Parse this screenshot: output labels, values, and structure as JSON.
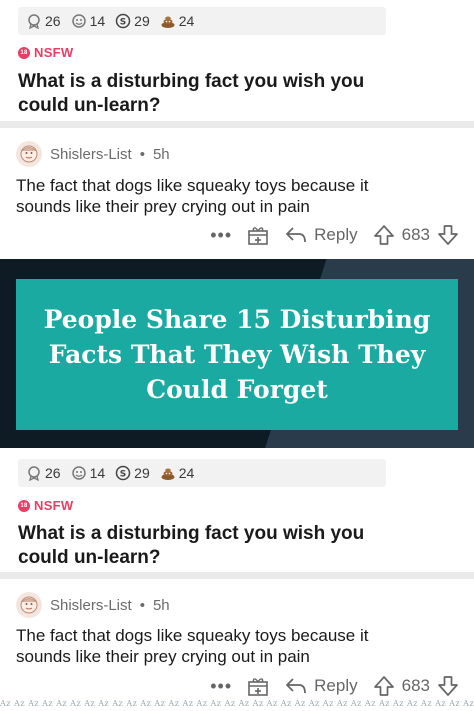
{
  "awards": [
    {
      "icon": "silver-award-icon",
      "count": "26"
    },
    {
      "icon": "helpful-award-icon",
      "count": "14"
    },
    {
      "icon": "coin-award-icon",
      "count": "29"
    },
    {
      "icon": "poop-award-icon",
      "count": "24"
    }
  ],
  "post": {
    "nsfw_label": "NSFW",
    "nsfw_badge": "18",
    "title_line1": "What is a disturbing fact you wish you",
    "title_line2": "could un-learn?"
  },
  "comment": {
    "author": "Shislers-List",
    "separator": "•",
    "age": "5h",
    "body_line1": "The fact that dogs like squeaky toys because it",
    "body_line2": "sounds like their prey crying out in pain",
    "more": "•••",
    "reply_label": "Reply",
    "score": "683"
  },
  "banner": {
    "line1": "People Share 15 Disturbing",
    "line2": "Facts That They Wish They",
    "line3": "Could Forget"
  },
  "watermark": "Az Az Az Az Az Az Az Az Az Az Az Az Az Az Az Az Az Az Az Az Az Az Az Az Az Az Az Az Az Az Az Az Az Az Az Az Az Az Az Az Az Az Az Az Az Az",
  "colors": {
    "nsfw": "#e83e63",
    "banner_teal": "#1baaa2",
    "banner_dark": "#0e1a24",
    "award_bar": "#f2f2f2"
  }
}
